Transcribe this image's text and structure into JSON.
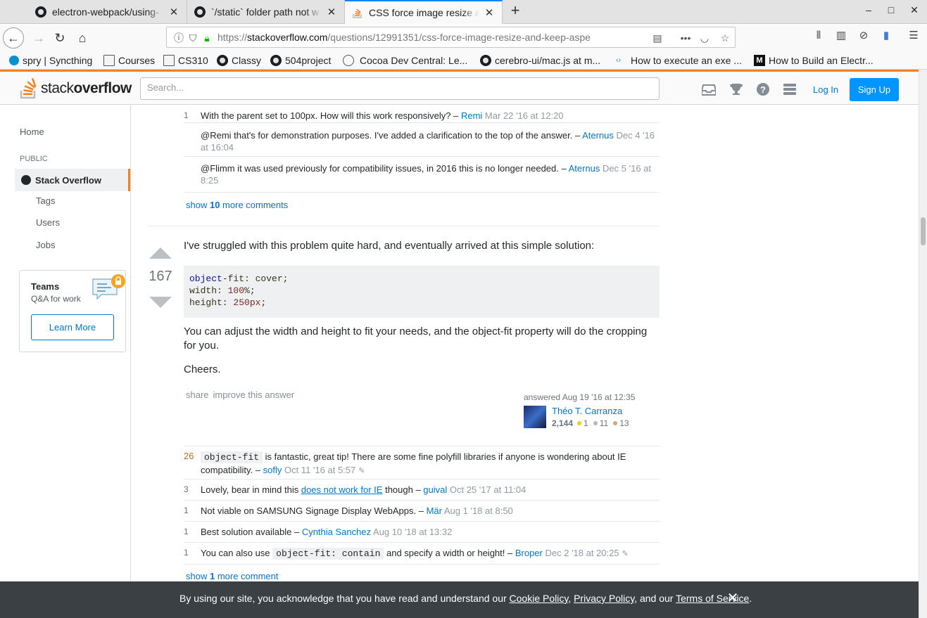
{
  "browser": {
    "tabs": [
      {
        "title": "electron-webpack/using-",
        "icon": "github-icon"
      },
      {
        "title": "`/static` folder path not w",
        "icon": "github-icon"
      },
      {
        "title": "CSS force image resize a",
        "icon": "stackoverflow-icon",
        "active": true
      }
    ],
    "url": {
      "prefix": "https://",
      "host": "stackoverflow.com",
      "path": "/questions/12991351/css-force-image-resize-and-keep-aspe"
    },
    "bookmarks": [
      {
        "label": "spry | Syncthing",
        "icon": "syncthing-icon"
      },
      {
        "label": "Courses",
        "icon": "folder-icon"
      },
      {
        "label": "CS310",
        "icon": "folder-icon"
      },
      {
        "label": "Classy",
        "icon": "github-icon"
      },
      {
        "label": "504project",
        "icon": "github-icon"
      },
      {
        "label": "Cocoa Dev Central: Le...",
        "icon": "globe-icon"
      },
      {
        "label": "cerebro-ui/mac.js at m...",
        "icon": "github-icon"
      },
      {
        "label": "How to execute an exe ...",
        "icon": "code-icon"
      },
      {
        "label": "How to Build an Electr...",
        "icon": "medium-icon"
      }
    ]
  },
  "so_header": {
    "logo_text_plain": "stack",
    "logo_text_bold": "overflow",
    "search_placeholder": "Search...",
    "login": "Log In",
    "signup": "Sign Up"
  },
  "left_nav": {
    "home": "Home",
    "public": "PUBLIC",
    "stack_overflow": "Stack Overflow",
    "tags": "Tags",
    "users": "Users",
    "jobs": "Jobs",
    "teams_title": "Teams",
    "teams_sub": "Q&A for work",
    "teams_button": "Learn More"
  },
  "prev_comments": [
    {
      "score": "1",
      "text": "With the parent set to 100px. How will this work responsively? – ",
      "user": "Remi",
      "date": "Mar 22 '16 at 12:20"
    },
    {
      "score": "",
      "text": "@Remi that's for demonstration purposes. I've added a clarification to the top of the answer. – ",
      "user": "Aternus",
      "date": "Dec 4 '16 at 16:04"
    },
    {
      "score": "",
      "text": "@Flimm it was used previously for compatibility issues, in 2016 this is no longer needed. – ",
      "user": "Aternus",
      "date": "Dec 5 '16 at 8:25"
    }
  ],
  "prev_show_more": {
    "pre": "show ",
    "count": "10",
    "post": " more comments"
  },
  "answer": {
    "votes": "167",
    "intro": "I've struggled with this problem quite hard, and eventually arrived at this simple solution:",
    "code": [
      {
        "kw": "object",
        "rest": "-fit: cover;"
      },
      {
        "kw": "",
        "rest": "width: ",
        "num": "100",
        "tail": "%;"
      },
      {
        "kw": "",
        "rest": "height: ",
        "num": "250px",
        "tail": ";"
      }
    ],
    "para2": "You can adjust the width and height to fit your needs, and the object-fit property will do the cropping for you.",
    "para3": "Cheers.",
    "share": "share",
    "improve": "improve this answer",
    "answered": "answered Aug 19 '16 at 12:35",
    "user_name": "Théo T. Carranza",
    "user_rep": "2,144",
    "badges": {
      "gold": "1",
      "silver": "11",
      "bronze": "13"
    }
  },
  "answer_comments": [
    {
      "score": "26",
      "code": "object-fit",
      "text": " is fantastic, great tip! There are some fine polyfill libraries if anyone is wondering about IE compatibility. – ",
      "user": "sofly",
      "date": "Oct 11 '16 at 5:57"
    },
    {
      "score": "3",
      "pre": "Lovely, bear in mind this ",
      "link": "does not work for IE",
      "post": " though – ",
      "user": "guival",
      "date": "Oct 25 '17 at 11:04"
    },
    {
      "score": "1",
      "text": "Not viable on SAMSUNG Signage Display WebApps. – ",
      "user": "Mär",
      "date": "Aug 1 '18 at 8:50"
    },
    {
      "score": "1",
      "text": "Best solution available – ",
      "user": "Cynthia Sanchez",
      "date": "Aug 10 '18 at 13:32"
    },
    {
      "score": "1",
      "pre": "You can also use ",
      "code": "object-fit: contain",
      "post": " and specify a width or height! – ",
      "user": "Broper",
      "date": "Dec 2 '18 at 20:25"
    }
  ],
  "answer_show_more": {
    "pre": "show ",
    "count": "1",
    "post": " more comment"
  },
  "cookie": {
    "text1": "By using our site, you acknowledge that you have read and understand our ",
    "cookie_policy": "Cookie Policy",
    "sep1": ", ",
    "privacy_policy": "Privacy Policy",
    "sep2": ", and our ",
    "terms": "Terms of Service",
    "end": "."
  },
  "colors": {
    "accent": "#f48024",
    "link": "#0077cc",
    "signup": "#0095ff",
    "banner": "#3b4045"
  }
}
